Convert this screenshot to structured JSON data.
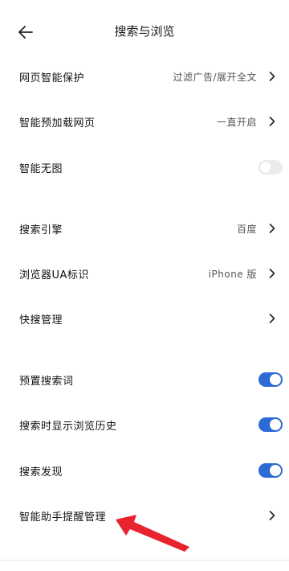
{
  "header": {
    "title": "搜索与浏览",
    "back_icon": "arrow-left-icon"
  },
  "rows": {
    "web_protection": {
      "label": "网页智能保护",
      "value": "过滤广告/展开全文"
    },
    "preload": {
      "label": "智能预加载网页",
      "value": "一直开启"
    },
    "no_image": {
      "label": "智能无图",
      "toggle": "off"
    },
    "search_engine": {
      "label": "搜索引擎",
      "value": "百度"
    },
    "ua": {
      "label": "浏览器UA标识",
      "value": "iPhone 版"
    },
    "quick_search": {
      "label": "快搜管理"
    },
    "preset_words": {
      "label": "预置搜索词",
      "toggle": "on"
    },
    "show_history": {
      "label": "搜索时显示浏览历史",
      "toggle": "on"
    },
    "discover": {
      "label": "搜索发现",
      "toggle": "on"
    },
    "assistant": {
      "label": "智能助手提醒管理"
    }
  },
  "colors": {
    "accent": "#2c6bd6",
    "annotation_arrow": "#e8232d",
    "toggle_off": "#ececec"
  },
  "icons": {
    "chevron": "chevron-right-icon"
  }
}
